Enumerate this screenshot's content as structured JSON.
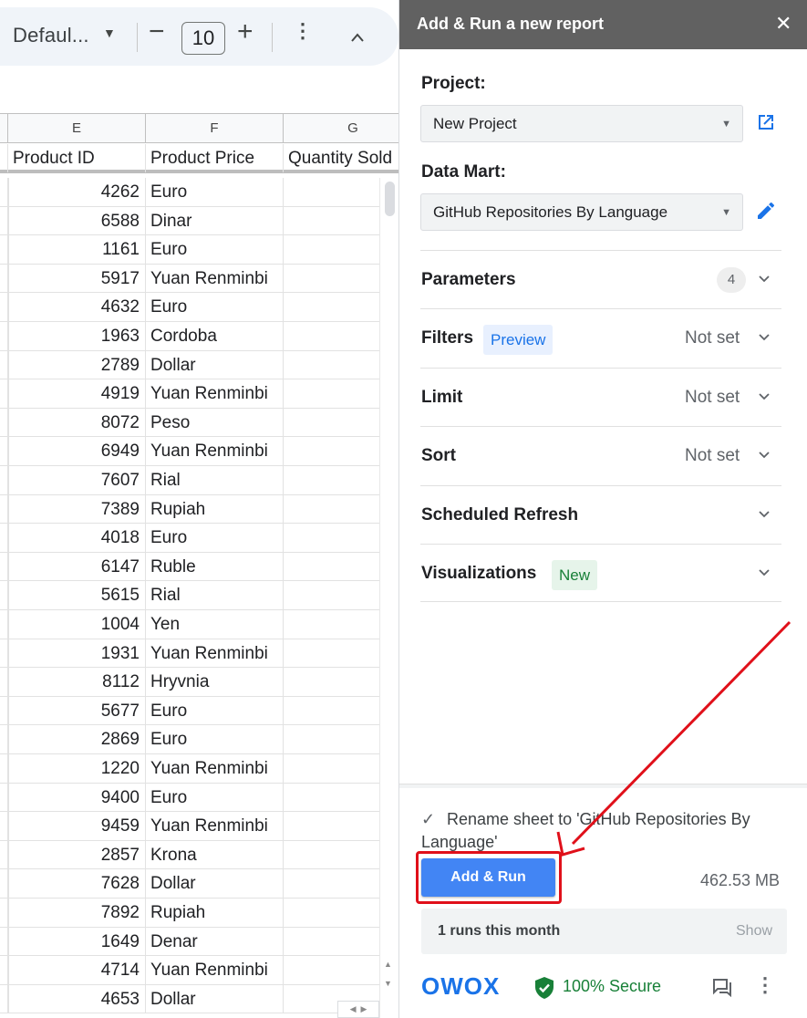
{
  "toolbar": {
    "font_name": "Defaul...",
    "font_size": "10",
    "minus_glyph": "−",
    "plus_glyph": "+",
    "more_glyph": "⋮"
  },
  "sheet": {
    "columns": [
      "E",
      "F",
      "G"
    ],
    "headers": [
      "Product ID",
      "Product Price",
      "Quantity Sold"
    ],
    "rows": [
      [
        "4262",
        "Euro"
      ],
      [
        "6588",
        "Dinar"
      ],
      [
        "1161",
        "Euro"
      ],
      [
        "5917",
        "Yuan Renminbi"
      ],
      [
        "4632",
        "Euro"
      ],
      [
        "1963",
        "Cordoba"
      ],
      [
        "2789",
        "Dollar"
      ],
      [
        "4919",
        "Yuan Renminbi"
      ],
      [
        "8072",
        "Peso"
      ],
      [
        "6949",
        "Yuan Renminbi"
      ],
      [
        "7607",
        "Rial"
      ],
      [
        "7389",
        "Rupiah"
      ],
      [
        "4018",
        "Euro"
      ],
      [
        "6147",
        "Ruble"
      ],
      [
        "5615",
        "Rial"
      ],
      [
        "1004",
        "Yen"
      ],
      [
        "1931",
        "Yuan Renminbi"
      ],
      [
        "8112",
        "Hryvnia"
      ],
      [
        "5677",
        "Euro"
      ],
      [
        "2869",
        "Euro"
      ],
      [
        "1220",
        "Yuan Renminbi"
      ],
      [
        "9400",
        "Euro"
      ],
      [
        "9459",
        "Yuan Renminbi"
      ],
      [
        "2857",
        "Krona"
      ],
      [
        "7628",
        "Dollar"
      ],
      [
        "7892",
        "Rupiah"
      ],
      [
        "1649",
        "Denar"
      ],
      [
        "4714",
        "Yuan Renminbi"
      ],
      [
        "4653",
        "Dollar"
      ]
    ]
  },
  "panel": {
    "title": "Add & Run a new report",
    "close_glyph": "✕",
    "project_label": "Project:",
    "project_value": "New Project",
    "datamart_label": "Data Mart:",
    "datamart_value": "GitHub Repositories By Language",
    "sections": {
      "parameters": {
        "label": "Parameters",
        "count": "4"
      },
      "filters": {
        "label": "Filters",
        "chip": "Preview",
        "value": "Not set"
      },
      "limit": {
        "label": "Limit",
        "value": "Not set"
      },
      "sort": {
        "label": "Sort",
        "value": "Not set"
      },
      "scheduled": {
        "label": "Scheduled Refresh"
      },
      "visualizations": {
        "label": "Visualizations",
        "chip": "New"
      }
    },
    "rename_checkbox": "Rename sheet to 'GitHub Repositories By Language'",
    "rename_checked": true,
    "run_button": "Add & Run",
    "data_size": "462.53 MB",
    "runs_text": "1 runs this month",
    "runs_show": "Show",
    "secure_text": "100% Secure",
    "brand": "OWOX"
  },
  "colors": {
    "accent_blue": "#4285f4",
    "link_blue": "#1a73e8",
    "secure_green": "#188038",
    "highlight_red": "#e0101a",
    "header_gray": "#616161"
  }
}
